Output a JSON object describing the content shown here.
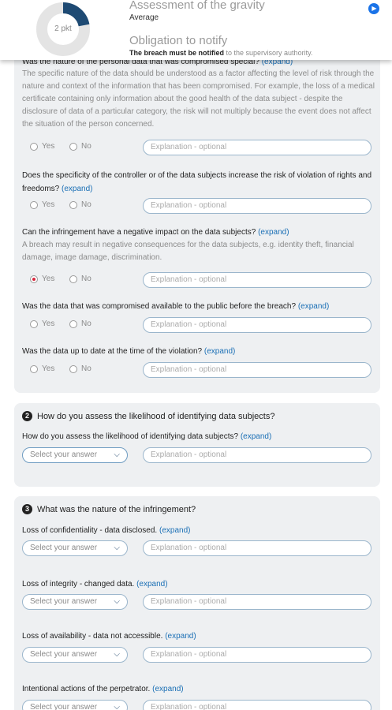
{
  "header": {
    "gauge_value": 0.22,
    "gauge_label": "2 pkt",
    "gauge_color": "#1e4a73",
    "gauge_track_color": "#e4e4e4",
    "title": "Assessment of the gravity",
    "level": "Average",
    "obligation_title": "Obligation to notify",
    "notice_bold": "The breach must be notified",
    "notice_rest": " to the supervisory authority.",
    "play_icon": "play-icon"
  },
  "section1": {
    "cut_question": "Was the nature of the personal data that was compromised special?",
    "cut_expand": "(expand)",
    "cut_description": "The specific nature of the data should be understood as a factor affecting the level of risk through the nature and context of the information that has been compromised. For example, the loss of a medical certificate containing only information about the good health of the data subject - despite the disclosure of data of a particular category, the risk will not multiply because the event does not affect the situation of the person concerned.",
    "questions": [
      {
        "text": "Does the specificity of the controller or of the data subjects increase the risk of violation of rights and freedoms?",
        "expand": "(expand)"
      },
      {
        "text": "Can the infringement have a negative impact on the data subjects?",
        "expand": "(expand)",
        "description": "A breach may result in negative consequences for the data subjects, e.g. identity theft, financial damage, image damage, discrimination."
      },
      {
        "text": "Was the data that was compromised available to the public before the breach?",
        "expand": "(expand)"
      },
      {
        "text": "Was the data up to date at the time of the violation?",
        "expand": "(expand)"
      }
    ],
    "yes_label": "Yes",
    "no_label": "No",
    "explanation_placeholder": "Explanation - optional",
    "selected_yes_color": "#d7263d"
  },
  "section2": {
    "number": "2",
    "title": "How do you assess the likelihood of identifying data subjects?",
    "question": "How do you assess the likelihood of identifying data subjects?",
    "expand": "(expand)",
    "select_placeholder": "Select your answer",
    "explanation_placeholder": "Explanation - optional"
  },
  "section3": {
    "number": "3",
    "title": "What was the nature of the infringement?",
    "questions": [
      {
        "text": "Loss of confidentiality - data disclosed.",
        "expand": "(expand)"
      },
      {
        "text": "Loss of integrity - changed data.",
        "expand": "(expand)"
      },
      {
        "text": "Loss of availability - data not accessible.",
        "expand": "(expand)"
      },
      {
        "text": "Intentional actions of the perpetrator.",
        "expand": "(expand)"
      }
    ],
    "select_placeholder": "Select your answer",
    "explanation_placeholder": "Explanation - optional"
  },
  "colors": {
    "link": "#1a6fb5",
    "card_bg": "#eef0f2",
    "input_border": "#9bb6cc"
  }
}
